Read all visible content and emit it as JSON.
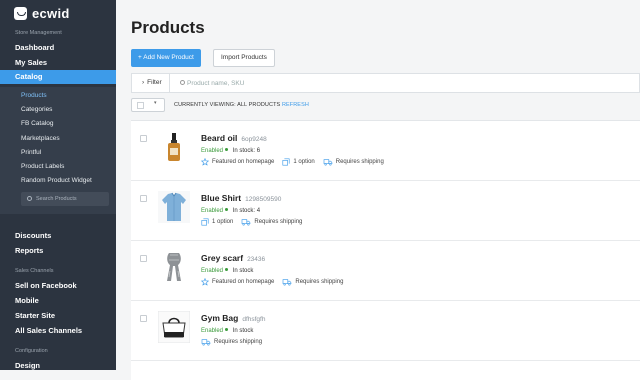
{
  "brand": {
    "name": "ecwid"
  },
  "sidebar": {
    "section_store": "Store Management",
    "dashboard": "Dashboard",
    "my_sales": "My Sales",
    "catalog": "Catalog",
    "catalog_items": [
      "Products",
      "Categories",
      "FB Catalog",
      "Marketplaces",
      "Printful",
      "Product Labels",
      "Random Product Widget"
    ],
    "search_placeholder": "Search Products",
    "discounts": "Discounts",
    "reports": "Reports",
    "section_channels": "Sales Channels",
    "sell_on_facebook": "Sell on Facebook",
    "mobile": "Mobile",
    "starter_site": "Starter Site",
    "all_sales_channels": "All Sales Channels",
    "section_config": "Configuration",
    "design": "Design"
  },
  "main": {
    "title": "Products",
    "add_button": "+ Add New Product",
    "import_button": "Import Products",
    "filter_label": "Filter",
    "search_placeholder": "Product name, SKU",
    "viewing_text": "CURRENTLY VIEWING: ALL PRODUCTS",
    "refresh": "REFRESH"
  },
  "products": [
    {
      "name": "Beard oil",
      "sku": "6op9248",
      "enabled": "Enabled",
      "stock": "In stock: 6",
      "tags": [
        "Featured on homepage",
        "1 option",
        "Requires shipping"
      ]
    },
    {
      "name": "Blue Shirt",
      "sku": "1298509590",
      "enabled": "Enabled",
      "stock": "In stock: 4",
      "tags": [
        "1 option",
        "Requires shipping"
      ]
    },
    {
      "name": "Grey scarf",
      "sku": "23436",
      "enabled": "Enabled",
      "stock": "In stock",
      "tags": [
        "Featured on homepage",
        "Requires shipping"
      ]
    },
    {
      "name": "Gym Bag",
      "sku": "dfhsfgfh",
      "enabled": "Enabled",
      "stock": "In stock",
      "tags": [
        "Requires shipping"
      ]
    }
  ],
  "colors": {
    "accent": "#3d9be9",
    "sidebar": "#2c3440",
    "enabled": "#3a9a3a"
  }
}
